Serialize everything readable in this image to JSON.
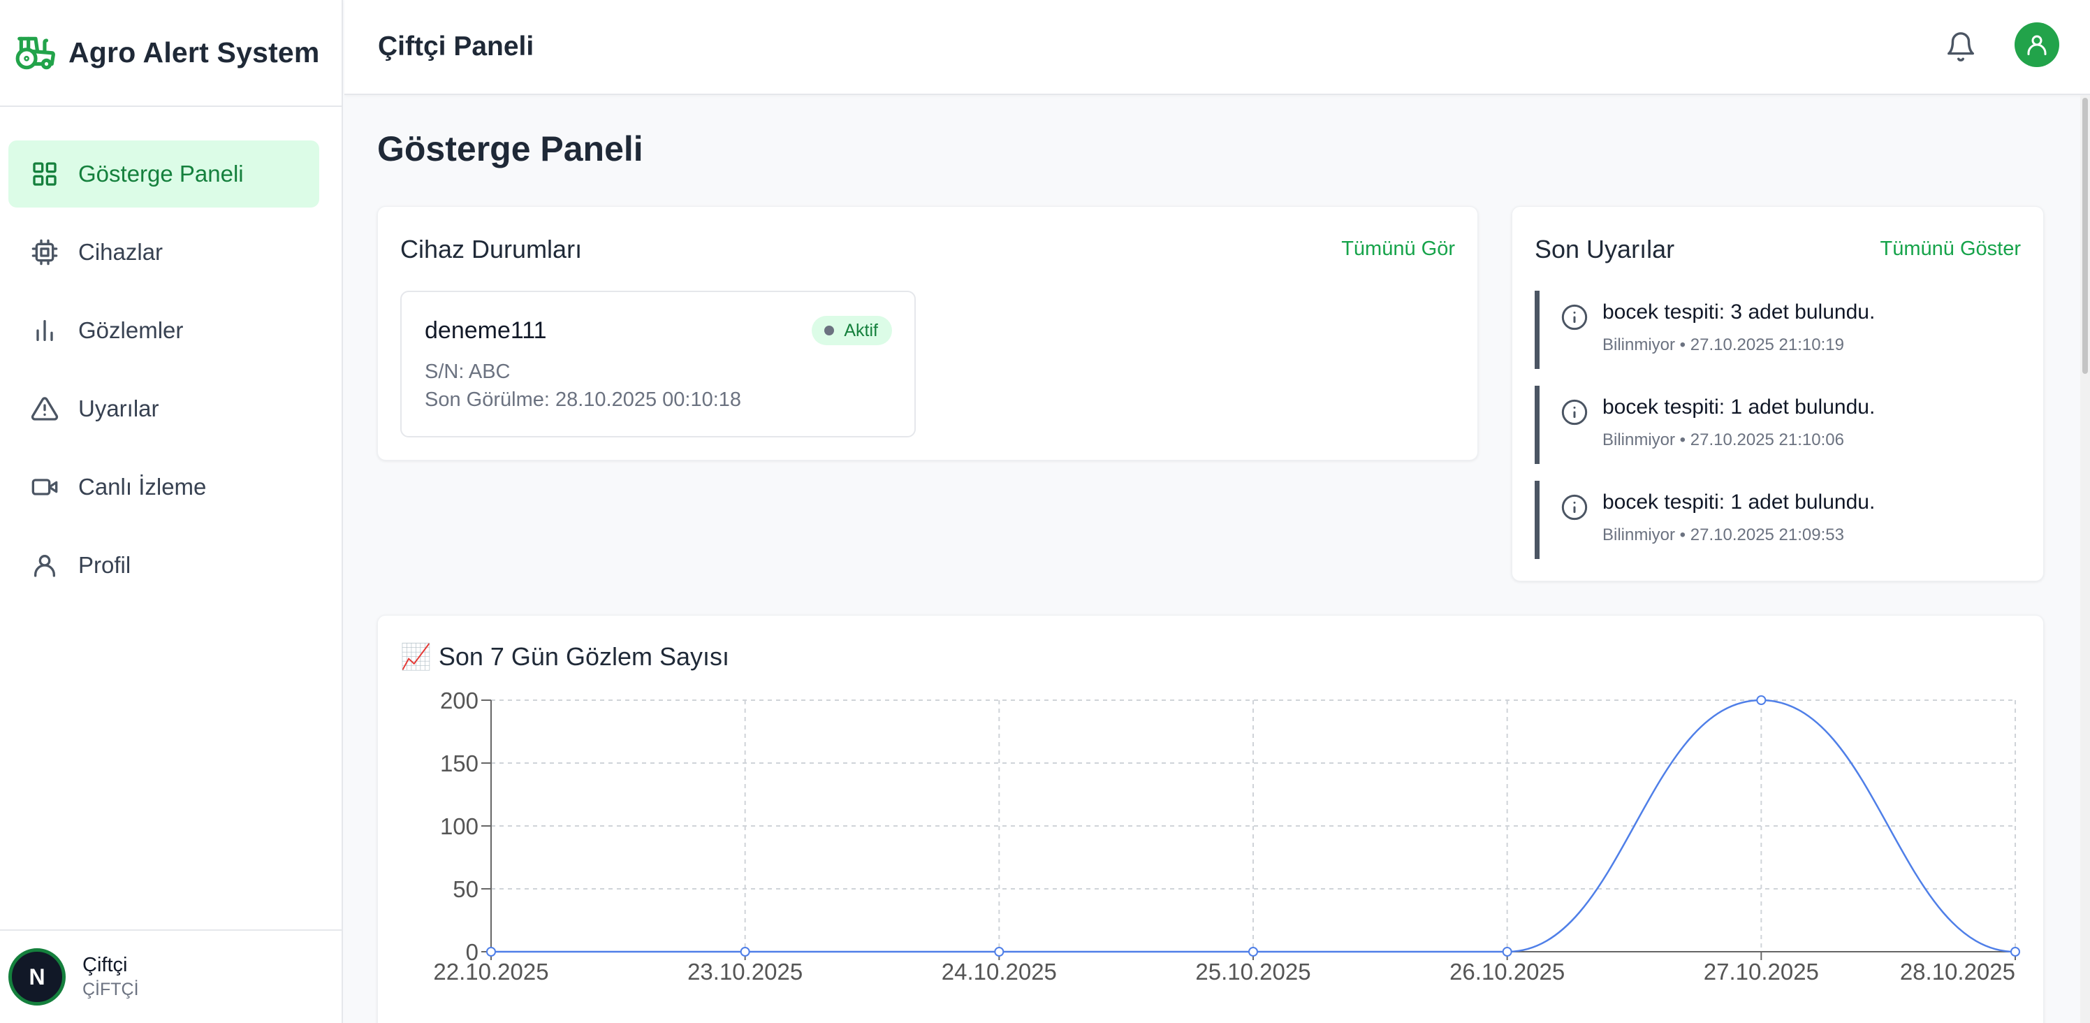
{
  "app": {
    "brand": "Agro Alert System"
  },
  "sidebar": {
    "items": [
      {
        "label": "Gösterge Paneli",
        "icon": "dashboard-grid-icon",
        "active": true
      },
      {
        "label": "Cihazlar",
        "icon": "chip-icon",
        "active": false
      },
      {
        "label": "Gözlemler",
        "icon": "bar-chart-icon",
        "active": false
      },
      {
        "label": "Uyarılar",
        "icon": "warning-triangle-icon",
        "active": false
      },
      {
        "label": "Canlı İzleme",
        "icon": "video-camera-icon",
        "active": false
      },
      {
        "label": "Profil",
        "icon": "user-icon",
        "active": false
      }
    ],
    "user": {
      "initial": "N",
      "name": "Çiftçi",
      "role": "ÇİFTÇİ"
    }
  },
  "header": {
    "title": "Çiftçi Paneli"
  },
  "main": {
    "page_title": "Gösterge Paneli",
    "devices": {
      "title": "Cihaz Durumları",
      "link": "Tümünü Gör",
      "items": [
        {
          "name": "deneme111",
          "status": "Aktif",
          "serial": "S/N: ABC",
          "last_seen": "Son Görülme: 28.10.2025 00:10:18"
        }
      ]
    },
    "alerts": {
      "title": "Son Uyarılar",
      "link": "Tümünü Göster",
      "items": [
        {
          "text": "bocek tespiti: 3 adet bulundu.",
          "source": "Bilinmiyor",
          "time": "27.10.2025 21:10:19"
        },
        {
          "text": "bocek tespiti: 1 adet bulundu.",
          "source": "Bilinmiyor",
          "time": "27.10.2025 21:10:06"
        },
        {
          "text": "bocek tespiti: 1 adet bulundu.",
          "source": "Bilinmiyor",
          "time": "27.10.2025 21:09:53"
        }
      ]
    },
    "chart": {
      "title": "📈 Son 7 Gün Gözlem Sayısı"
    }
  },
  "colors": {
    "accent": "#16a34a",
    "line": "#4f7fe8",
    "badge_bg": "#dcfce7"
  },
  "chart_data": {
    "type": "line",
    "title": "📈 Son 7 Gün Gözlem Sayısı",
    "categories": [
      "22.10.2025",
      "23.10.2025",
      "24.10.2025",
      "25.10.2025",
      "26.10.2025",
      "27.10.2025",
      "28.10.2025"
    ],
    "values": [
      0,
      0,
      0,
      0,
      0,
      200,
      0
    ],
    "ylim": [
      0,
      200
    ],
    "yticks": [
      0,
      50,
      100,
      150,
      200
    ],
    "grid": true,
    "legend": false
  }
}
